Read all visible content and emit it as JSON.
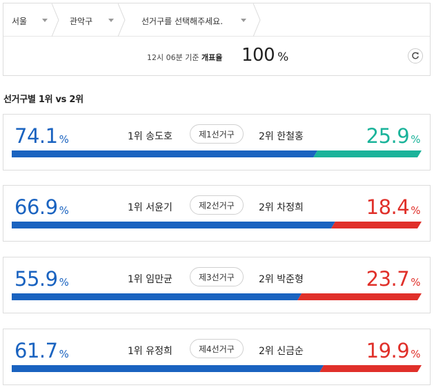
{
  "filters": {
    "region": "서울",
    "district": "관악구",
    "constituency_placeholder": "선거구를 선택해주세요."
  },
  "status": {
    "basis_time": "12시 06분 기준",
    "basis_label": "개표율",
    "count_percent": "100",
    "percent_unit": "%"
  },
  "section": {
    "title": "선거구별 1위 vs 2위"
  },
  "colors": {
    "first": "#1a63c0",
    "second_teal": "#1ab39a",
    "second_red": "#e0302a"
  },
  "percent_unit": "%",
  "cards": [
    {
      "first_pct": "74.1",
      "first_label": "1위 송도호",
      "district": "제1선거구",
      "second_label": "2위 한철홍",
      "second_pct": "25.9",
      "second_color": "#1ab39a",
      "first_value": 74.1,
      "second_value": 25.9
    },
    {
      "first_pct": "66.9",
      "first_label": "1위 서윤기",
      "district": "제2선거구",
      "second_label": "2위 차정희",
      "second_pct": "18.4",
      "second_color": "#e0302a",
      "first_value": 66.9,
      "second_value": 18.4
    },
    {
      "first_pct": "55.9",
      "first_label": "1위 임만균",
      "district": "제3선거구",
      "second_label": "2위 박준형",
      "second_pct": "23.7",
      "second_color": "#e0302a",
      "first_value": 55.9,
      "second_value": 23.7
    },
    {
      "first_pct": "61.7",
      "first_label": "1위 유정희",
      "district": "제4선거구",
      "second_label": "2위 신금순",
      "second_pct": "19.9",
      "second_color": "#e0302a",
      "first_value": 61.7,
      "second_value": 19.9
    }
  ]
}
